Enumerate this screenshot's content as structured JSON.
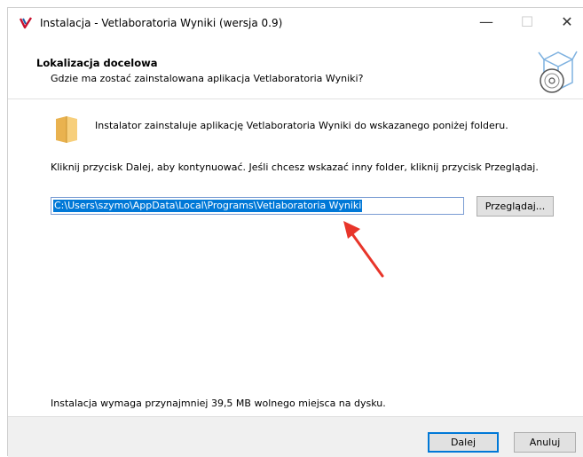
{
  "window": {
    "title": "Instalacja - Vetlaboratoria Wyniki (wersja 0.9)",
    "controls": {
      "minimize": "—",
      "maximize": "☐",
      "close": "✕"
    }
  },
  "header": {
    "title": "Lokalizacja docelowa",
    "subtitle": "Gdzie ma zostać zainstalowana aplikacja Vetlaboratoria Wyniki?"
  },
  "body": {
    "intro": "Instalator zainstaluje aplikację Vetlaboratoria Wyniki do wskazanego poniżej folderu.",
    "instruction": "Kliknij przycisk Dalej, aby kontynuować. Jeśli chcesz wskazać inny folder, kliknij przycisk Przeglądaj.",
    "path_value": "C:\\Users\\szymo\\AppData\\Local\\Programs\\Vetlaboratoria Wyniki",
    "browse_label": "Przeglądaj...",
    "space_note": "Instalacja wymaga przynajmniej 39,5 MB wolnego miejsca na dysku."
  },
  "footer": {
    "next_label": "Dalej",
    "cancel_label": "Anuluj"
  },
  "colors": {
    "selection": "#0078d7",
    "annotation_arrow": "#e8352a",
    "folder": "#f5c56a"
  }
}
